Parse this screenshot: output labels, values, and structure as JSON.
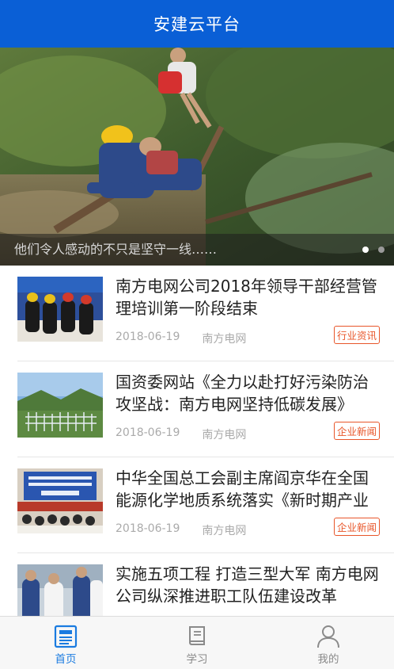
{
  "header": {
    "title": "安建云平台"
  },
  "banner": {
    "caption": "他们令人感动的不只是坚守一线……",
    "dot_count": 2,
    "active_dot": 0
  },
  "news": [
    {
      "title": "南方电网公司2018年领导干部经营管理培训第一阶段结束",
      "date": "2018-06-19",
      "source": "南方电网",
      "tag": "行业资讯",
      "thumb": "meeting-photo"
    },
    {
      "title": "国资委网站《全力以赴打好污染防治攻坚战：南方电网坚持低碳发展》",
      "date": "2018-06-19",
      "source": "南方电网",
      "tag": "企业新闻",
      "thumb": "substation-photo"
    },
    {
      "title": "中华全国总工会副主席阎京华在全国能源化学地质系统落实《新时期产业工人队伍建设改革方案》推进会上讲话",
      "date": "2018-06-19",
      "source": "南方电网",
      "tag": "企业新闻",
      "thumb": "conference-photo"
    },
    {
      "title": "实施五项工程 打造三型大军 南方电网公司纵深推进职工队伍建设改革",
      "date": "",
      "source": "",
      "tag": "",
      "thumb": "workers-photo"
    }
  ],
  "tabs": [
    {
      "label": "首页",
      "icon": "newspaper-icon",
      "active": true
    },
    {
      "label": "学习",
      "icon": "book-icon",
      "active": false
    },
    {
      "label": "我的",
      "icon": "user-icon",
      "active": false
    }
  ],
  "colors": {
    "header": "#0a5fd6",
    "tag": "#e8562a",
    "active_tab": "#1a7be0"
  }
}
